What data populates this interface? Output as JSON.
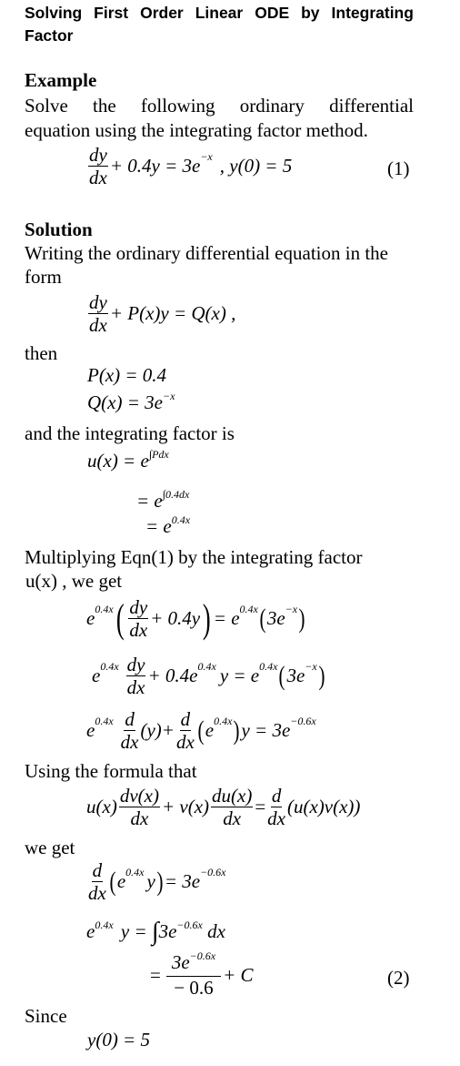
{
  "title": {
    "line1_words": [
      "Solving",
      "First",
      "Order",
      "Linear",
      "ODE",
      "by",
      "Integrating"
    ],
    "line2": "Factor"
  },
  "example": {
    "heading": "Example",
    "line1_words": [
      "Solve",
      "the",
      "following",
      "ordinary",
      "differential"
    ],
    "line2": "equation using the integrating factor method.",
    "eq1": {
      "num": "dy",
      "den": "dx",
      "rest": "+ 0.4y = 3e",
      "exp": "−x",
      "condition": ",  y(0) = 5",
      "number": "(1)"
    }
  },
  "solution": {
    "heading": "Solution",
    "line1": "Writing the ordinary differential equation in the",
    "line2": "form",
    "form_eq": {
      "num": "dy",
      "den": "dx",
      "rest": "+ P(x)y = Q(x) ,"
    },
    "then": "then",
    "p_eq": "P(x) = 0.4",
    "q_eq": {
      "base": "Q(x) = 3e",
      "exp": "−x"
    },
    "factor_text": "and the integrating factor is",
    "u1": {
      "base": "u(x) = e",
      "exp": "∫Pdx"
    },
    "u2": {
      "base": "= e",
      "exp": "∫0.4dx"
    },
    "u3": {
      "base": "= e",
      "exp": "0.4x"
    },
    "multiply_line1": "Multiplying Eqn(1) by the integrating factor",
    "multiply_line2": "u(x) , we get",
    "m1": {
      "lhs_exp": "0.4x",
      "num": "dy",
      "den": "dx",
      "inner": "+ 0.4y",
      "rhs": "= e",
      "rhs_exp": "0.4x",
      "paren": "3e",
      "paren_exp": "−x"
    },
    "m2": {
      "lhs_exp": "0.4x",
      "num": "dy",
      "den": "dx",
      "mid": "+ 0.4e",
      "mid_exp": "0.4x",
      "mid2": "y = e",
      "rhs_exp": "0.4x",
      "paren": "3e",
      "paren_exp": "−x"
    },
    "m3": {
      "lhs_exp": "0.4x",
      "num": "d",
      "den": "dx",
      "y": "(y)+",
      "num2": "d",
      "den2": "dx",
      "inner_exp": "0.4x",
      "rhs": "y = 3e",
      "rhs_exp": "−0.6x"
    },
    "formula_text": "Using the formula that",
    "formula": {
      "u": "u(x)",
      "num1": "dv(x)",
      "den1": "dx",
      "plus_v": "+ v(x)",
      "num2": "du(x)",
      "den2": "dx",
      "eq": "=",
      "num3": "d",
      "den3": "dx",
      "rhs": "(u(x)v(x))"
    },
    "we_get": "we get",
    "g1": {
      "num": "d",
      "den": "dx",
      "inner_exp": "0.4x",
      "rhs": "= 3e",
      "rhs_exp": "−0.6x"
    },
    "g2": {
      "lhs_exp": "0.4x",
      "lhs": "y =",
      "integrand": "3e",
      "int_exp": "−0.6x",
      "dx": "dx"
    },
    "g3": {
      "eq": "=",
      "num": "3e",
      "num_exp": "−0.6x",
      "den": "− 0.6",
      "rest": "+ C",
      "number": "(2)"
    },
    "since": "Since",
    "initial": "y(0) = 5"
  }
}
